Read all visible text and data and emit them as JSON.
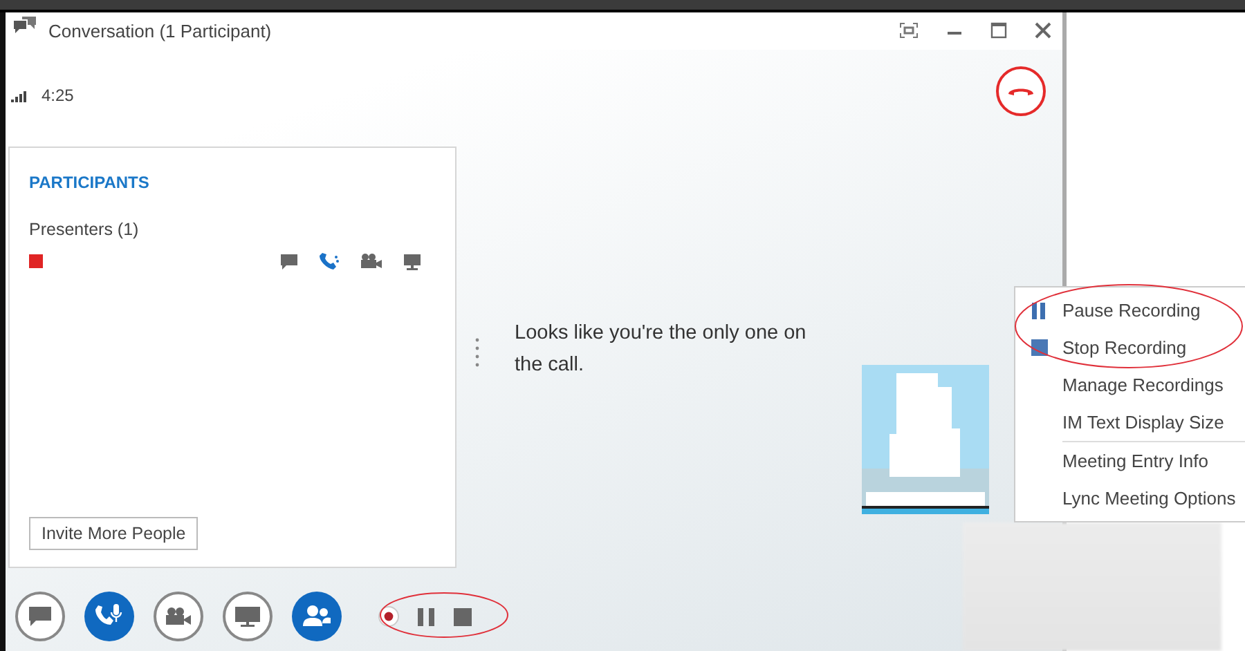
{
  "window": {
    "title": "Conversation (1 Participant)"
  },
  "call": {
    "duration": "4:25"
  },
  "participants": {
    "heading": "PARTICIPANTS",
    "group": "Presenters (1)",
    "people": [
      {
        "color": "#e02424"
      }
    ],
    "invite_button": "Invite More People"
  },
  "stage": {
    "message": "Looks like you're the only one on the call."
  },
  "menu": {
    "items": [
      {
        "label": "Pause Recording",
        "kind": "pause"
      },
      {
        "label": "Stop Recording",
        "kind": "stop"
      },
      {
        "label": "Manage Recordings",
        "kind": "plain"
      },
      {
        "label": "IM Text Display Size",
        "kind": "plain"
      },
      {
        "label": "Meeting Entry Info",
        "kind": "plain",
        "divider_before": true
      },
      {
        "label": "Lync Meeting Options",
        "kind": "plain"
      }
    ]
  },
  "toolbar": {
    "buttons": [
      {
        "kind": "chat",
        "active": false
      },
      {
        "kind": "phone",
        "active": true
      },
      {
        "kind": "video",
        "active": false
      },
      {
        "kind": "present",
        "active": false
      },
      {
        "kind": "people",
        "active": true
      }
    ],
    "recording": [
      {
        "kind": "record"
      },
      {
        "kind": "pause"
      },
      {
        "kind": "stop"
      }
    ]
  }
}
